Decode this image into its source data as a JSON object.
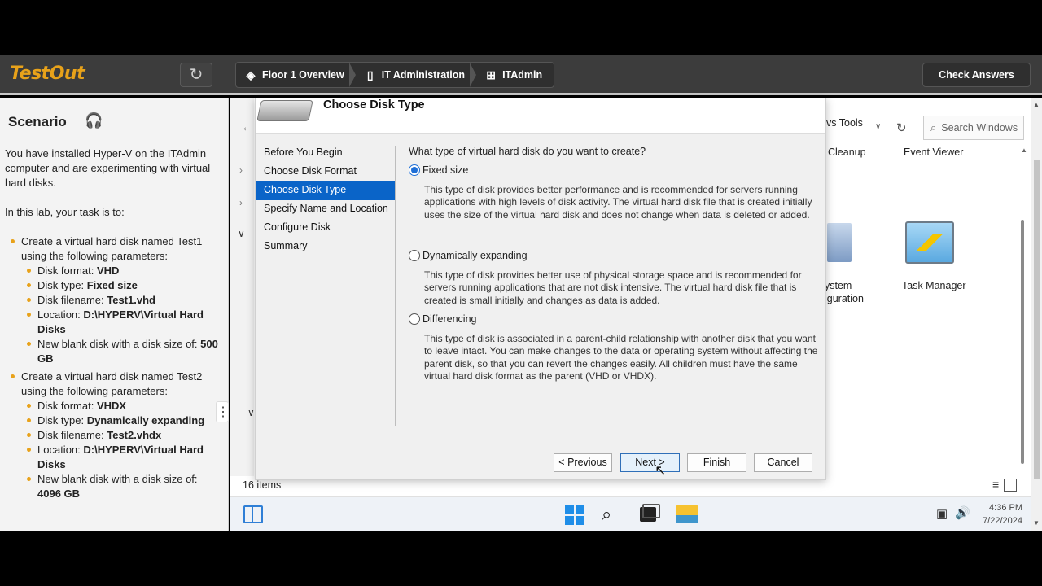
{
  "topbar": {
    "logo": "TestOut",
    "crumbs": [
      "Floor 1 Overview",
      "IT Administration",
      "ITAdmin"
    ],
    "check_answers": "Check Answers"
  },
  "scenario": {
    "title": "Scenario",
    "intro": "You have installed Hyper-V on the ITAdmin computer and are experimenting with virtual hard disks.",
    "task_intro": "In this lab, your task is to:",
    "tasks": [
      {
        "text": "Create a virtual hard disk named Test1 using the following parameters:",
        "params": [
          {
            "label": "Disk format: ",
            "value": "VHD"
          },
          {
            "label": "Disk type: ",
            "value": "Fixed size"
          },
          {
            "label": "Disk filename: ",
            "value": "Test1.vhd"
          },
          {
            "label": "Location: ",
            "value": "D:\\HYPERV\\Virtual Hard Disks"
          },
          {
            "label": "New blank disk with a disk size of: ",
            "value": "500 GB"
          }
        ]
      },
      {
        "text": "Create a virtual hard disk named Test2 using the following parameters:",
        "params": [
          {
            "label": "Disk format: ",
            "value": "VHDX"
          },
          {
            "label": "Disk type: ",
            "value": "Dynamically expanding"
          },
          {
            "label": "Disk filename: ",
            "value": "Test2.vhdx"
          },
          {
            "label": "Location: ",
            "value": "D:\\HYPERV\\Virtual Hard Disks"
          },
          {
            "label": "New blank disk with a disk size of: ",
            "value": "4096 GB"
          }
        ]
      }
    ]
  },
  "explorer": {
    "toolbar_text": "vs Tools",
    "search_placeholder": "Search Windows",
    "icons": {
      "cleanup": "Cleanup",
      "event_viewer": "Event Viewer",
      "system_config_1": "ystem",
      "system_config_2": "iguration",
      "task_manager": "Task Manager"
    },
    "items_count": "16 items"
  },
  "taskbar": {
    "time": "4:36 PM",
    "date": "7/22/2024"
  },
  "dialog": {
    "title": "Choose Disk Type",
    "nav": [
      "Before You Begin",
      "Choose Disk Format",
      "Choose Disk Type",
      "Specify Name and Location",
      "Configure Disk",
      "Summary"
    ],
    "active_nav_index": 2,
    "question": "What type of virtual hard disk do you want to create?",
    "options": [
      {
        "label": "Fixed size",
        "checked": true,
        "desc": "This type of disk provides better performance and is recommended for servers running applications with high levels of disk activity. The virtual hard disk file that is created initially uses the size of the virtual hard disk and does not change when data is deleted or added."
      },
      {
        "label": "Dynamically expanding",
        "checked": false,
        "desc": "This type of disk provides better use of physical storage space and is recommended for servers running applications that are not disk intensive. The virtual hard disk file that is created is small initially and changes as data is added."
      },
      {
        "label": "Differencing",
        "checked": false,
        "desc": "This type of disk is associated in a parent-child relationship with another disk that you want to leave intact. You can make changes to the data or operating system without affecting the parent disk, so that you can revert the changes easily. All children must have the same virtual hard disk format as the parent (VHD or VHDX)."
      }
    ],
    "buttons": {
      "previous": "< Previous",
      "next": "Next >",
      "finish": "Finish",
      "cancel": "Cancel"
    }
  },
  "colors": {
    "accent_orange": "#e8a21a",
    "topbar_bg": "#3c3c3c",
    "selection_blue": "#0a64c8"
  }
}
